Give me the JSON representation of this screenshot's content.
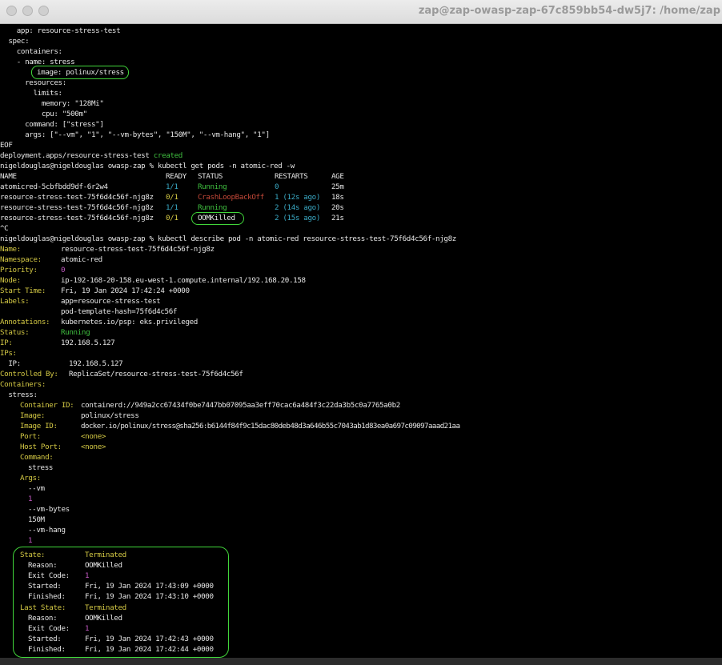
{
  "window": {
    "title": "zap@zap-owasp-zap-67c859bb54-dw5j7: /home/zap",
    "buttons": [
      "close",
      "minimize",
      "zoom"
    ]
  },
  "yaml": {
    "app": "    app: resource-stress-test",
    "spec": "  spec:",
    "containers": "    containers:",
    "name": "    - name: stress",
    "image": "image: polinux/stress",
    "resources": "      resources:",
    "limits": "        limits:",
    "memory": "          memory: \"128Mi\"",
    "cpu": "          cpu: \"500m\"",
    "command": "      command: [\"stress\"]",
    "args": "      args: [\"--vm\", \"1\", \"--vm-bytes\", \"150M\", \"--vm-hang\", \"1\"]",
    "eof": "EOF"
  },
  "created": {
    "text": "deployment.apps/resource-stress-test",
    "status": "created"
  },
  "prompt": "nigeldouglas@nigeldouglas owasp-zap % ",
  "cmd_get": "kubectl get pods -n atomic-red -w",
  "pods": {
    "headers": [
      "NAME",
      "READY",
      "STATUS",
      "RESTARTS",
      "AGE"
    ],
    "rows": [
      {
        "name": "atomicred-5cbfbdd9df-6r2w4",
        "ready": "1/1",
        "status": "Running",
        "restarts": "0",
        "age": "25m"
      },
      {
        "name": "resource-stress-test-75f6d4c56f-njg8z",
        "ready": "0/1",
        "status": "CrashLoopBackOff",
        "restarts": "1 (12s ago)",
        "age": "18s"
      },
      {
        "name": "resource-stress-test-75f6d4c56f-njg8z",
        "ready": "1/1",
        "status": "Running",
        "restarts": "2 (14s ago)",
        "age": "20s"
      },
      {
        "name": "resource-stress-test-75f6d4c56f-njg8z",
        "ready": "0/1",
        "status": "OOMKilled",
        "restarts": "2 (15s ago)",
        "age": "21s"
      }
    ]
  },
  "ctrl_c": "^C",
  "cmd_describe": "kubectl describe pod -n atomic-red resource-stress-test-75f6d4c56f-njg8z",
  "describe": {
    "name_k": "Name:",
    "name_v": "resource-stress-test-75f6d4c56f-njg8z",
    "ns_k": "Namespace:",
    "ns_v": "atomic-red",
    "prio_k": "Priority:",
    "prio_v": "0",
    "node_k": "Node:",
    "node_v": "ip-192-168-20-158.eu-west-1.compute.internal/192.168.20.158",
    "start_k": "Start Time:",
    "start_v": "Fri, 19 Jan 2024 17:42:24 +0000",
    "labels_k": "Labels:",
    "labels_v1": "app=resource-stress-test",
    "labels_v2": "pod-template-hash=75f6d4c56f",
    "ann_k": "Annotations:",
    "ann_v": "kubernetes.io/psp: eks.privileged",
    "status_k": "Status:",
    "status_v": "Running",
    "ip_k": "IP:",
    "ip_v": "192.168.5.127",
    "ips_k": "IPs:",
    "ips_ip_k": "  IP:",
    "ips_ip_v": "192.168.5.127",
    "ctrl_k": "Controlled By:",
    "ctrl_v": "ReplicaSet/resource-stress-test-75f6d4c56f",
    "containers_k": "Containers:",
    "stress_k": "  stress:",
    "cid_k": "Container ID:",
    "cid_v": "containerd://949a2cc67434f0be7447bb07095aa3eff70cac6a484f3c22da3b5c0a7765a0b2",
    "img_k": "Image:",
    "img_v": "polinux/stress",
    "imgid_k": "Image ID:",
    "imgid_v": "docker.io/polinux/stress@sha256:b6144f84f9c15dac80deb48d3a646b55c7043ab1d83ea0a697c09097aaad21aa",
    "port_k": "Port:",
    "port_v": "<none>",
    "hport_k": "Host Port:",
    "hport_v": "<none>",
    "command_k": "Command:",
    "command_v": "stress",
    "args_k": "Args:",
    "args_v": [
      "--vm",
      "1",
      "--vm-bytes",
      "150M",
      "--vm-hang",
      "1"
    ]
  },
  "state": {
    "state_k": "State:",
    "state_v": "Terminated",
    "reason_k": "Reason:",
    "reason_v": "OOMKilled",
    "exit_k": "Exit Code:",
    "exit_v": "1",
    "started_k": "Started:",
    "started_v": "Fri, 19 Jan 2024 17:43:09 +0000",
    "finished_k": "Finished:",
    "finished_v": "Fri, 19 Jan 2024 17:43:10 +0000"
  },
  "last_state": {
    "state_k": "Last State:",
    "state_v": "Terminated",
    "reason_k": "Reason:",
    "reason_v": "OOMKilled",
    "exit_k": "Exit Code:",
    "exit_v": "1",
    "started_k": "Started:",
    "started_v": "Fri, 19 Jan 2024 17:42:43 +0000",
    "finished_k": "Finished:",
    "finished_v": "Fri, 19 Jan 2024 17:42:44 +0000"
  },
  "colors": {
    "yellow": "#d3c844",
    "green": "#3fbf3f",
    "red": "#c44838",
    "cyan": "#3aa9c4",
    "magenta": "#c45ac4",
    "highlight": "#41d63a"
  }
}
